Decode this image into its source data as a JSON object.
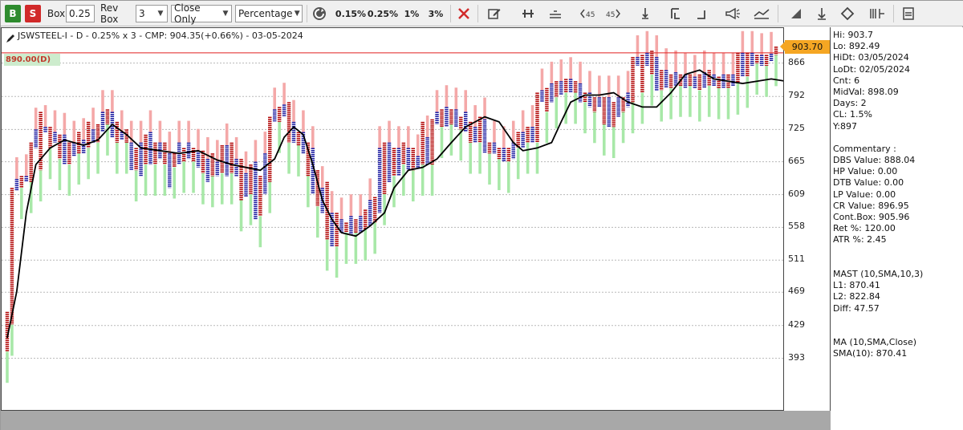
{
  "toolbar": {
    "buy_label": "B",
    "sell_label": "S",
    "box_label": "Box",
    "box_value": "0.25",
    "rev_box_label": "Rev Box",
    "rev_box_value": "3",
    "method_value": "Close Only",
    "scale_value": "Percentage",
    "pct_presets": [
      "0.15%",
      "0.25%",
      "1%",
      "3%"
    ],
    "icons": [
      "refresh-icon",
      "delete-icon",
      "edit-icon",
      "pin-icon",
      "horizontal-line-icon",
      "angle-45-left-icon",
      "angle-45-right-icon",
      "vertical-line-icon",
      "bracket-left-icon",
      "bracket-right-icon",
      "megaphone-icon",
      "trend-icon",
      "triangle-icon",
      "diamond-icon",
      "ruler-icon",
      "panel-icon"
    ]
  },
  "chart": {
    "title": "JSWSTEEL-I - D - 0.25% x 3 - CMP: 904.35(+0.66%) - 03-05-2024",
    "reference_label": "890.00(D)",
    "current_price": "903.70",
    "colors": {
      "x_column": "#b00000",
      "o_column": "#1a1aa0",
      "bear_band": "#f4a8a8",
      "bull_band": "#a8e8a8",
      "ma_line": "#000000",
      "reference_line": "#e02020",
      "price_badge": "#f5a623"
    }
  },
  "chart_data": {
    "type": "line",
    "title": "JSWSTEEL-I - D - 0.25% x 3 - CMP: 904.35(+0.66%) - 03-05-2024",
    "y_scale": "log",
    "ylim": [
      365,
      915
    ],
    "y_ticks": [
      393,
      429,
      469,
      511,
      558,
      609,
      665,
      725,
      792,
      866
    ],
    "reference_level": 890,
    "last_price": 903.7,
    "columns": [
      {
        "t": "X",
        "lo": 400,
        "hi": 445
      },
      {
        "t": "X",
        "lo": 430,
        "hi": 620
      },
      {
        "t": "O",
        "lo": 615,
        "hi": 635
      },
      {
        "t": "X",
        "lo": 620,
        "hi": 640
      },
      {
        "t": "O",
        "lo": 630,
        "hi": 640
      },
      {
        "t": "X",
        "lo": 630,
        "hi": 700
      },
      {
        "t": "O",
        "lo": 690,
        "hi": 725
      },
      {
        "t": "X",
        "lo": 650,
        "hi": 760
      },
      {
        "t": "O",
        "lo": 720,
        "hi": 730
      },
      {
        "t": "X",
        "lo": 690,
        "hi": 730
      },
      {
        "t": "O",
        "lo": 700,
        "hi": 720
      },
      {
        "t": "X",
        "lo": 670,
        "hi": 715
      },
      {
        "t": "O",
        "lo": 660,
        "hi": 715
      },
      {
        "t": "X",
        "lo": 660,
        "hi": 700
      },
      {
        "t": "O",
        "lo": 675,
        "hi": 700
      },
      {
        "t": "X",
        "lo": 680,
        "hi": 720
      },
      {
        "t": "O",
        "lo": 680,
        "hi": 705
      },
      {
        "t": "X",
        "lo": 690,
        "hi": 740
      },
      {
        "t": "O",
        "lo": 700,
        "hi": 725
      },
      {
        "t": "X",
        "lo": 700,
        "hi": 735
      },
      {
        "t": "O",
        "lo": 720,
        "hi": 760
      },
      {
        "t": "X",
        "lo": 735,
        "hi": 765
      },
      {
        "t": "O",
        "lo": 710,
        "hi": 760
      },
      {
        "t": "X",
        "lo": 700,
        "hi": 740
      },
      {
        "t": "O",
        "lo": 705,
        "hi": 720
      },
      {
        "t": "X",
        "lo": 700,
        "hi": 725
      },
      {
        "t": "O",
        "lo": 650,
        "hi": 700
      },
      {
        "t": "X",
        "lo": 650,
        "hi": 690
      },
      {
        "t": "O",
        "lo": 640,
        "hi": 700
      },
      {
        "t": "X",
        "lo": 660,
        "hi": 715
      },
      {
        "t": "O",
        "lo": 660,
        "hi": 720
      },
      {
        "t": "X",
        "lo": 660,
        "hi": 700
      },
      {
        "t": "O",
        "lo": 670,
        "hi": 700
      },
      {
        "t": "X",
        "lo": 660,
        "hi": 700
      },
      {
        "t": "O",
        "lo": 620,
        "hi": 680
      },
      {
        "t": "X",
        "lo": 655,
        "hi": 680
      },
      {
        "t": "O",
        "lo": 660,
        "hi": 700
      },
      {
        "t": "X",
        "lo": 665,
        "hi": 690
      },
      {
        "t": "O",
        "lo": 670,
        "hi": 700
      },
      {
        "t": "X",
        "lo": 665,
        "hi": 690
      },
      {
        "t": "O",
        "lo": 655,
        "hi": 685
      },
      {
        "t": "X",
        "lo": 645,
        "hi": 685
      },
      {
        "t": "O",
        "lo": 630,
        "hi": 670
      },
      {
        "t": "X",
        "lo": 640,
        "hi": 680
      },
      {
        "t": "O",
        "lo": 640,
        "hi": 665
      },
      {
        "t": "X",
        "lo": 645,
        "hi": 695
      },
      {
        "t": "O",
        "lo": 640,
        "hi": 695
      },
      {
        "t": "X",
        "lo": 645,
        "hi": 700
      },
      {
        "t": "O",
        "lo": 640,
        "hi": 670
      },
      {
        "t": "X",
        "lo": 600,
        "hi": 670
      },
      {
        "t": "O",
        "lo": 605,
        "hi": 645
      },
      {
        "t": "X",
        "lo": 610,
        "hi": 660
      },
      {
        "t": "O",
        "lo": 570,
        "hi": 665
      },
      {
        "t": "X",
        "lo": 575,
        "hi": 640
      },
      {
        "t": "O",
        "lo": 610,
        "hi": 680
      },
      {
        "t": "X",
        "lo": 630,
        "hi": 750
      },
      {
        "t": "O",
        "lo": 740,
        "hi": 765
      },
      {
        "t": "X",
        "lo": 740,
        "hi": 770
      },
      {
        "t": "O",
        "lo": 750,
        "hi": 775
      },
      {
        "t": "X",
        "lo": 700,
        "hi": 780
      },
      {
        "t": "O",
        "lo": 700,
        "hi": 740
      },
      {
        "t": "X",
        "lo": 695,
        "hi": 720
      },
      {
        "t": "O",
        "lo": 680,
        "hi": 720
      },
      {
        "t": "X",
        "lo": 640,
        "hi": 700
      },
      {
        "t": "O",
        "lo": 610,
        "hi": 690
      },
      {
        "t": "X",
        "lo": 590,
        "hi": 650
      },
      {
        "t": "O",
        "lo": 580,
        "hi": 620
      },
      {
        "t": "X",
        "lo": 540,
        "hi": 630
      },
      {
        "t": "O",
        "lo": 530,
        "hi": 580
      },
      {
        "t": "X",
        "lo": 530,
        "hi": 580
      },
      {
        "t": "O",
        "lo": 550,
        "hi": 570
      },
      {
        "t": "X",
        "lo": 550,
        "hi": 565
      },
      {
        "t": "O",
        "lo": 545,
        "hi": 575
      },
      {
        "t": "X",
        "lo": 550,
        "hi": 570
      },
      {
        "t": "O",
        "lo": 550,
        "hi": 575
      },
      {
        "t": "X",
        "lo": 555,
        "hi": 585
      },
      {
        "t": "O",
        "lo": 560,
        "hi": 600
      },
      {
        "t": "X",
        "lo": 565,
        "hi": 605
      },
      {
        "t": "O",
        "lo": 580,
        "hi": 690
      },
      {
        "t": "X",
        "lo": 610,
        "hi": 700
      },
      {
        "t": "O",
        "lo": 630,
        "hi": 700
      },
      {
        "t": "X",
        "lo": 640,
        "hi": 690
      },
      {
        "t": "O",
        "lo": 640,
        "hi": 690
      },
      {
        "t": "X",
        "lo": 660,
        "hi": 700
      },
      {
        "t": "O",
        "lo": 650,
        "hi": 690
      },
      {
        "t": "X",
        "lo": 650,
        "hi": 690
      },
      {
        "t": "O",
        "lo": 655,
        "hi": 675
      },
      {
        "t": "X",
        "lo": 660,
        "hi": 740
      },
      {
        "t": "O",
        "lo": 660,
        "hi": 710
      },
      {
        "t": "X",
        "lo": 660,
        "hi": 745
      },
      {
        "t": "O",
        "lo": 735,
        "hi": 760
      },
      {
        "t": "X",
        "lo": 730,
        "hi": 765
      },
      {
        "t": "O",
        "lo": 730,
        "hi": 770
      },
      {
        "t": "X",
        "lo": 735,
        "hi": 765
      },
      {
        "t": "O",
        "lo": 730,
        "hi": 765
      },
      {
        "t": "X",
        "lo": 725,
        "hi": 750
      },
      {
        "t": "O",
        "lo": 720,
        "hi": 760
      },
      {
        "t": "X",
        "lo": 700,
        "hi": 740
      },
      {
        "t": "O",
        "lo": 700,
        "hi": 730
      },
      {
        "t": "X",
        "lo": 700,
        "hi": 750
      },
      {
        "t": "O",
        "lo": 680,
        "hi": 745
      },
      {
        "t": "X",
        "lo": 680,
        "hi": 700
      },
      {
        "t": "O",
        "lo": 680,
        "hi": 700
      },
      {
        "t": "X",
        "lo": 670,
        "hi": 690
      },
      {
        "t": "O",
        "lo": 665,
        "hi": 690
      },
      {
        "t": "X",
        "lo": 665,
        "hi": 690
      },
      {
        "t": "O",
        "lo": 670,
        "hi": 700
      },
      {
        "t": "X",
        "lo": 690,
        "hi": 720
      },
      {
        "t": "O",
        "lo": 690,
        "hi": 720
      },
      {
        "t": "X",
        "lo": 700,
        "hi": 730
      },
      {
        "t": "O",
        "lo": 700,
        "hi": 730
      },
      {
        "t": "X",
        "lo": 700,
        "hi": 800
      },
      {
        "t": "O",
        "lo": 780,
        "hi": 805
      },
      {
        "t": "X",
        "lo": 760,
        "hi": 810
      },
      {
        "t": "O",
        "lo": 780,
        "hi": 820
      },
      {
        "t": "X",
        "lo": 790,
        "hi": 825
      },
      {
        "t": "O",
        "lo": 795,
        "hi": 825
      },
      {
        "t": "X",
        "lo": 800,
        "hi": 830
      },
      {
        "t": "O",
        "lo": 800,
        "hi": 830
      },
      {
        "t": "X",
        "lo": 800,
        "hi": 825
      },
      {
        "t": "O",
        "lo": 780,
        "hi": 820
      },
      {
        "t": "X",
        "lo": 780,
        "hi": 800
      },
      {
        "t": "O",
        "lo": 770,
        "hi": 800
      },
      {
        "t": "X",
        "lo": 760,
        "hi": 790
      },
      {
        "t": "O",
        "lo": 770,
        "hi": 790
      },
      {
        "t": "X",
        "lo": 735,
        "hi": 790
      },
      {
        "t": "O",
        "lo": 730,
        "hi": 790
      },
      {
        "t": "X",
        "lo": 730,
        "hi": 780
      },
      {
        "t": "O",
        "lo": 750,
        "hi": 790
      },
      {
        "t": "X",
        "lo": 760,
        "hi": 790
      },
      {
        "t": "O",
        "lo": 770,
        "hi": 800
      },
      {
        "t": "X",
        "lo": 780,
        "hi": 880
      },
      {
        "t": "O",
        "lo": 860,
        "hi": 880
      },
      {
        "t": "X",
        "lo": 800,
        "hi": 885
      },
      {
        "t": "O",
        "lo": 860,
        "hi": 890
      },
      {
        "t": "X",
        "lo": 840,
        "hi": 895
      },
      {
        "t": "O",
        "lo": 805,
        "hi": 880
      },
      {
        "t": "X",
        "lo": 805,
        "hi": 850
      },
      {
        "t": "O",
        "lo": 810,
        "hi": 850
      },
      {
        "t": "X",
        "lo": 810,
        "hi": 840
      },
      {
        "t": "O",
        "lo": 815,
        "hi": 845
      },
      {
        "t": "X",
        "lo": 815,
        "hi": 840
      },
      {
        "t": "O",
        "lo": 810,
        "hi": 840
      },
      {
        "t": "X",
        "lo": 815,
        "hi": 840
      },
      {
        "t": "O",
        "lo": 810,
        "hi": 835
      },
      {
        "t": "X",
        "lo": 805,
        "hi": 840
      },
      {
        "t": "O",
        "lo": 810,
        "hi": 845
      },
      {
        "t": "X",
        "lo": 815,
        "hi": 850
      },
      {
        "t": "O",
        "lo": 815,
        "hi": 840
      },
      {
        "t": "X",
        "lo": 810,
        "hi": 835
      },
      {
        "t": "O",
        "lo": 810,
        "hi": 840
      },
      {
        "t": "X",
        "lo": 810,
        "hi": 840
      },
      {
        "t": "O",
        "lo": 815,
        "hi": 840
      },
      {
        "t": "X",
        "lo": 820,
        "hi": 890
      },
      {
        "t": "O",
        "lo": 835,
        "hi": 890
      },
      {
        "t": "X",
        "lo": 835,
        "hi": 890
      },
      {
        "t": "O",
        "lo": 860,
        "hi": 890
      },
      {
        "t": "X",
        "lo": 865,
        "hi": 885
      },
      {
        "t": "O",
        "lo": 860,
        "hi": 885
      },
      {
        "t": "X",
        "lo": 860,
        "hi": 885
      },
      {
        "t": "O",
        "lo": 870,
        "hi": 888
      },
      {
        "t": "X",
        "lo": 885,
        "hi": 905
      }
    ],
    "ma_line": [
      [
        0,
        415
      ],
      [
        2,
        470
      ],
      [
        4,
        580
      ],
      [
        6,
        660
      ],
      [
        9,
        690
      ],
      [
        12,
        705
      ],
      [
        16,
        695
      ],
      [
        19,
        705
      ],
      [
        22,
        735
      ],
      [
        25,
        715
      ],
      [
        28,
        690
      ],
      [
        32,
        685
      ],
      [
        36,
        680
      ],
      [
        40,
        685
      ],
      [
        44,
        668
      ],
      [
        47,
        660
      ],
      [
        50,
        655
      ],
      [
        53,
        650
      ],
      [
        56,
        670
      ],
      [
        58,
        710
      ],
      [
        60,
        730
      ],
      [
        62,
        715
      ],
      [
        64,
        660
      ],
      [
        66,
        600
      ],
      [
        68,
        570
      ],
      [
        70,
        550
      ],
      [
        73,
        545
      ],
      [
        76,
        560
      ],
      [
        79,
        580
      ],
      [
        81,
        620
      ],
      [
        84,
        650
      ],
      [
        87,
        655
      ],
      [
        90,
        670
      ],
      [
        93,
        700
      ],
      [
        96,
        730
      ],
      [
        98,
        740
      ],
      [
        100,
        750
      ],
      [
        103,
        740
      ],
      [
        106,
        700
      ],
      [
        108,
        685
      ],
      [
        111,
        690
      ],
      [
        114,
        700
      ],
      [
        116,
        740
      ],
      [
        118,
        780
      ],
      [
        121,
        795
      ],
      [
        124,
        795
      ],
      [
        127,
        800
      ],
      [
        130,
        780
      ],
      [
        133,
        770
      ],
      [
        136,
        770
      ],
      [
        139,
        800
      ],
      [
        142,
        840
      ],
      [
        145,
        850
      ],
      [
        148,
        830
      ],
      [
        151,
        825
      ],
      [
        154,
        820
      ],
      [
        157,
        825
      ],
      [
        160,
        830
      ],
      [
        163,
        825
      ],
      [
        166,
        820
      ],
      [
        169,
        840
      ],
      [
        172,
        850
      ],
      [
        174,
        870
      ],
      [
        176,
        880
      ]
    ]
  },
  "yaxis_labels": [
    "866",
    "792",
    "725",
    "665",
    "609",
    "558",
    "511",
    "469",
    "429",
    "393"
  ],
  "side_panel": {
    "stats": [
      "Hi: 903.7",
      "Lo: 892.49",
      "HiDt: 03/05/2024",
      "LoDt: 02/05/2024",
      "Cnt: 6",
      "MidVal: 898.09",
      "Days: 2",
      "CL: 1.5%",
      "Y:897"
    ],
    "commentary_title": "Commentary :",
    "commentary": [
      "DBS Value:  888.04",
      "HP Value: 0.00",
      "DTB Value: 0.00",
      "LP Value: 0.00",
      "CR Value: 896.95",
      "Cont.Box: 905.96",
      "Ret %: 120.00",
      "ATR %: 2.45"
    ],
    "mast": [
      "MAST (10,SMA,10,3)",
      "L1: 870.41",
      "L2: 822.84",
      "Diff: 47.57"
    ],
    "ma": [
      "MA (10,SMA,Close)",
      "SMA(10): 870.41"
    ]
  }
}
